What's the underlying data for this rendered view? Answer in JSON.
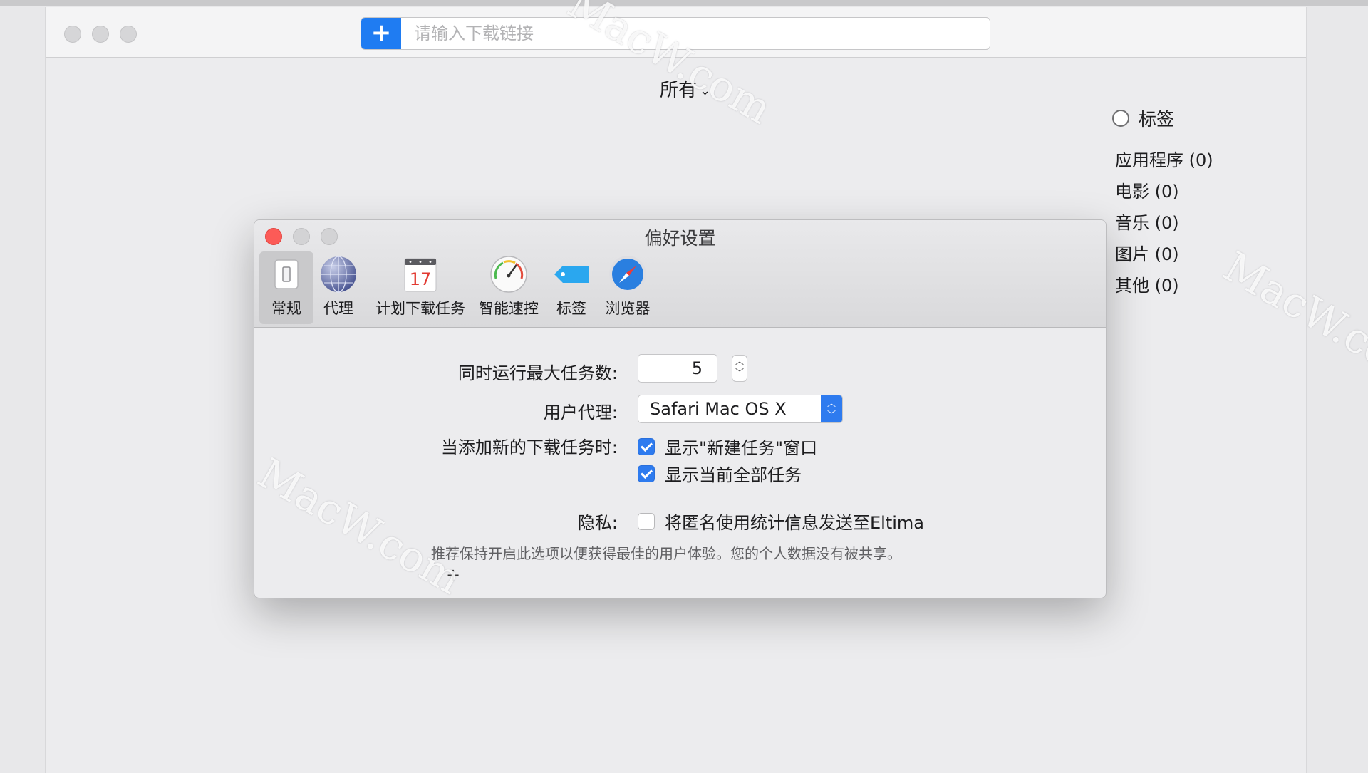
{
  "app": {
    "url_placeholder": "请输入下载链接",
    "add_symbol": "+",
    "filter_label": "所有",
    "filter_chevron": "⌄"
  },
  "tags_panel": {
    "header": "标签",
    "items": [
      {
        "label": "应用程序 (0)"
      },
      {
        "label": "电影 (0)"
      },
      {
        "label": "音乐 (0)"
      },
      {
        "label": "图片 (0)"
      },
      {
        "label": "其他 (0)"
      }
    ]
  },
  "prefs": {
    "title": "偏好设置",
    "tabs": [
      {
        "label": "常规",
        "icon": "switch-icon"
      },
      {
        "label": "代理",
        "icon": "globe-icon"
      },
      {
        "label": "计划下载任务",
        "icon": "calendar-icon",
        "calendar_day": "17"
      },
      {
        "label": "智能速控",
        "icon": "speedometer-icon"
      },
      {
        "label": "标签",
        "icon": "tag-icon"
      },
      {
        "label": "浏览器",
        "icon": "compass-icon"
      }
    ],
    "max_tasks_label": "同时运行最大任务数:",
    "max_tasks_value": "5",
    "user_agent_label": "用户代理:",
    "user_agent_value": "Safari Mac OS X",
    "on_add_label": "当添加新的下载任务时:",
    "show_new_task_label": "显示\"新建任务\"窗口",
    "show_new_task_checked": true,
    "show_all_tasks_label": "显示当前全部任务",
    "show_all_tasks_checked": true,
    "privacy_label": "隐私:",
    "send_stats_label": "将匿名使用统计信息发送至Eltima",
    "send_stats_checked": false,
    "privacy_hint": "推荐保持开启此选项以便获得最佳的用户体验。您的个人数据没有被共享。"
  },
  "watermark": "MacW.com",
  "colors": {
    "accent": "#2e7bef",
    "add_button": "#1f7cf2",
    "close_button": "#fc5b57"
  }
}
